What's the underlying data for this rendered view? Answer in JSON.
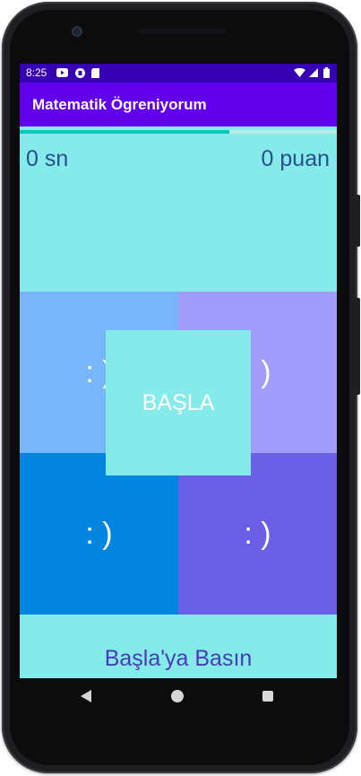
{
  "colors": {
    "statusbar": "#3700b3",
    "appbar": "#6200ee",
    "screen_bg": "#84eaea",
    "tile_top_left": "#78b6fb",
    "tile_top_right": "#a29cfb",
    "tile_bottom_left": "#0086e0",
    "tile_bottom_right": "#6a5fe6",
    "start_button": "#84eaea",
    "progress_fill": "#03c8bc"
  },
  "status": {
    "time": "8:25",
    "icons": [
      "youtube-icon",
      "app-icon",
      "sim-card-icon",
      "wifi-icon",
      "signal-icon",
      "battery-icon"
    ]
  },
  "app": {
    "title": "Matematik Ögreniyorum"
  },
  "progress": {
    "value": 0.66
  },
  "game": {
    "timer": "0 sn",
    "score": "0 puan",
    "start_label": "BAŞLA",
    "hint": "Başla'ya Basın",
    "tiles": [
      {
        "id": "top-left",
        "label": ": )"
      },
      {
        "id": "top-right",
        "label": ": )"
      },
      {
        "id": "bottom-left",
        "label": ": )"
      },
      {
        "id": "bottom-right",
        "label": ": )"
      }
    ]
  },
  "nav": {
    "icons": [
      "back-icon",
      "home-icon",
      "recents-icon"
    ]
  }
}
